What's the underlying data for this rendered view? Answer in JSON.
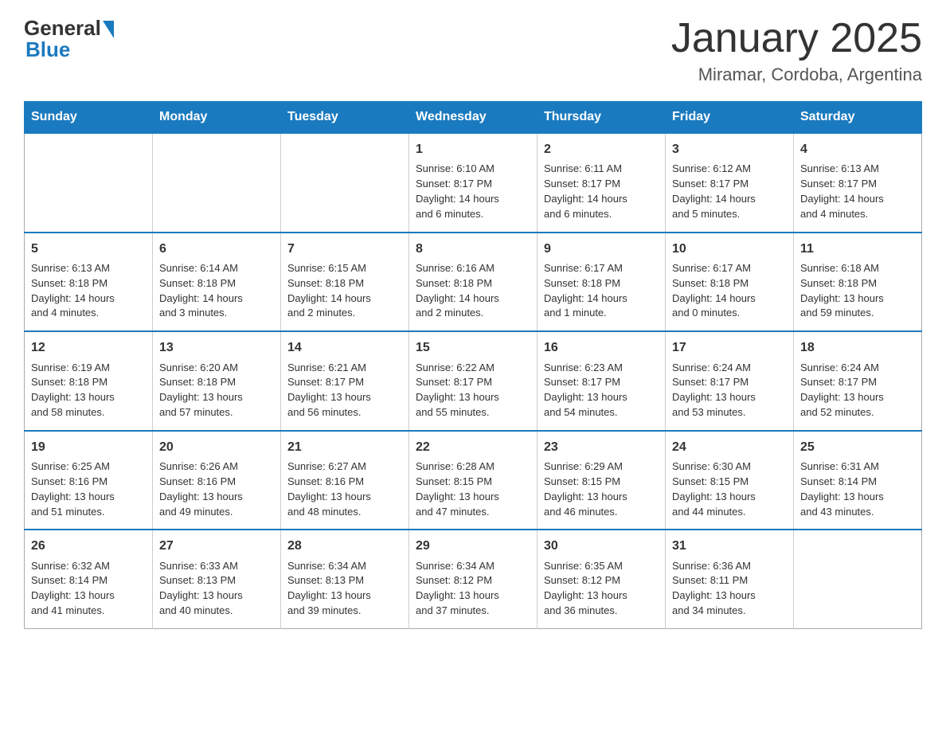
{
  "logo": {
    "general_text": "General",
    "blue_text": "Blue"
  },
  "title": "January 2025",
  "location": "Miramar, Cordoba, Argentina",
  "weekdays": [
    "Sunday",
    "Monday",
    "Tuesday",
    "Wednesday",
    "Thursday",
    "Friday",
    "Saturday"
  ],
  "weeks": [
    [
      {
        "day": "",
        "info": ""
      },
      {
        "day": "",
        "info": ""
      },
      {
        "day": "",
        "info": ""
      },
      {
        "day": "1",
        "info": "Sunrise: 6:10 AM\nSunset: 8:17 PM\nDaylight: 14 hours\nand 6 minutes."
      },
      {
        "day": "2",
        "info": "Sunrise: 6:11 AM\nSunset: 8:17 PM\nDaylight: 14 hours\nand 6 minutes."
      },
      {
        "day": "3",
        "info": "Sunrise: 6:12 AM\nSunset: 8:17 PM\nDaylight: 14 hours\nand 5 minutes."
      },
      {
        "day": "4",
        "info": "Sunrise: 6:13 AM\nSunset: 8:17 PM\nDaylight: 14 hours\nand 4 minutes."
      }
    ],
    [
      {
        "day": "5",
        "info": "Sunrise: 6:13 AM\nSunset: 8:18 PM\nDaylight: 14 hours\nand 4 minutes."
      },
      {
        "day": "6",
        "info": "Sunrise: 6:14 AM\nSunset: 8:18 PM\nDaylight: 14 hours\nand 3 minutes."
      },
      {
        "day": "7",
        "info": "Sunrise: 6:15 AM\nSunset: 8:18 PM\nDaylight: 14 hours\nand 2 minutes."
      },
      {
        "day": "8",
        "info": "Sunrise: 6:16 AM\nSunset: 8:18 PM\nDaylight: 14 hours\nand 2 minutes."
      },
      {
        "day": "9",
        "info": "Sunrise: 6:17 AM\nSunset: 8:18 PM\nDaylight: 14 hours\nand 1 minute."
      },
      {
        "day": "10",
        "info": "Sunrise: 6:17 AM\nSunset: 8:18 PM\nDaylight: 14 hours\nand 0 minutes."
      },
      {
        "day": "11",
        "info": "Sunrise: 6:18 AM\nSunset: 8:18 PM\nDaylight: 13 hours\nand 59 minutes."
      }
    ],
    [
      {
        "day": "12",
        "info": "Sunrise: 6:19 AM\nSunset: 8:18 PM\nDaylight: 13 hours\nand 58 minutes."
      },
      {
        "day": "13",
        "info": "Sunrise: 6:20 AM\nSunset: 8:18 PM\nDaylight: 13 hours\nand 57 minutes."
      },
      {
        "day": "14",
        "info": "Sunrise: 6:21 AM\nSunset: 8:17 PM\nDaylight: 13 hours\nand 56 minutes."
      },
      {
        "day": "15",
        "info": "Sunrise: 6:22 AM\nSunset: 8:17 PM\nDaylight: 13 hours\nand 55 minutes."
      },
      {
        "day": "16",
        "info": "Sunrise: 6:23 AM\nSunset: 8:17 PM\nDaylight: 13 hours\nand 54 minutes."
      },
      {
        "day": "17",
        "info": "Sunrise: 6:24 AM\nSunset: 8:17 PM\nDaylight: 13 hours\nand 53 minutes."
      },
      {
        "day": "18",
        "info": "Sunrise: 6:24 AM\nSunset: 8:17 PM\nDaylight: 13 hours\nand 52 minutes."
      }
    ],
    [
      {
        "day": "19",
        "info": "Sunrise: 6:25 AM\nSunset: 8:16 PM\nDaylight: 13 hours\nand 51 minutes."
      },
      {
        "day": "20",
        "info": "Sunrise: 6:26 AM\nSunset: 8:16 PM\nDaylight: 13 hours\nand 49 minutes."
      },
      {
        "day": "21",
        "info": "Sunrise: 6:27 AM\nSunset: 8:16 PM\nDaylight: 13 hours\nand 48 minutes."
      },
      {
        "day": "22",
        "info": "Sunrise: 6:28 AM\nSunset: 8:15 PM\nDaylight: 13 hours\nand 47 minutes."
      },
      {
        "day": "23",
        "info": "Sunrise: 6:29 AM\nSunset: 8:15 PM\nDaylight: 13 hours\nand 46 minutes."
      },
      {
        "day": "24",
        "info": "Sunrise: 6:30 AM\nSunset: 8:15 PM\nDaylight: 13 hours\nand 44 minutes."
      },
      {
        "day": "25",
        "info": "Sunrise: 6:31 AM\nSunset: 8:14 PM\nDaylight: 13 hours\nand 43 minutes."
      }
    ],
    [
      {
        "day": "26",
        "info": "Sunrise: 6:32 AM\nSunset: 8:14 PM\nDaylight: 13 hours\nand 41 minutes."
      },
      {
        "day": "27",
        "info": "Sunrise: 6:33 AM\nSunset: 8:13 PM\nDaylight: 13 hours\nand 40 minutes."
      },
      {
        "day": "28",
        "info": "Sunrise: 6:34 AM\nSunset: 8:13 PM\nDaylight: 13 hours\nand 39 minutes."
      },
      {
        "day": "29",
        "info": "Sunrise: 6:34 AM\nSunset: 8:12 PM\nDaylight: 13 hours\nand 37 minutes."
      },
      {
        "day": "30",
        "info": "Sunrise: 6:35 AM\nSunset: 8:12 PM\nDaylight: 13 hours\nand 36 minutes."
      },
      {
        "day": "31",
        "info": "Sunrise: 6:36 AM\nSunset: 8:11 PM\nDaylight: 13 hours\nand 34 minutes."
      },
      {
        "day": "",
        "info": ""
      }
    ]
  ]
}
